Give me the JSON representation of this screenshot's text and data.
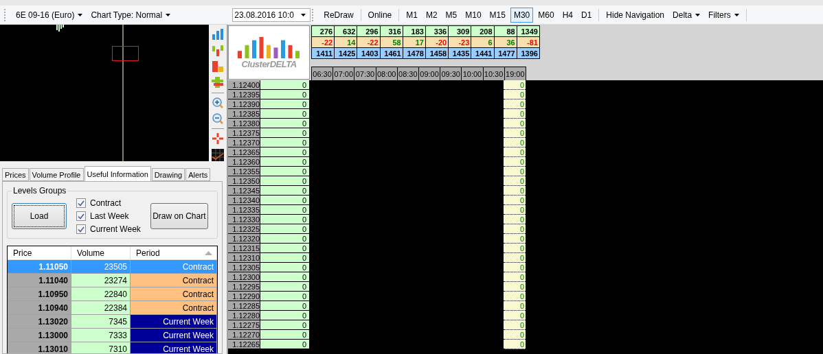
{
  "toolbar": {
    "instrument": "6E 09-16 (Euro)",
    "chart_type": "Chart Type: Normal",
    "date": "23.08.2016 10:0",
    "redraw": "ReDraw",
    "online": "Online",
    "timeframes": [
      {
        "label": "M1",
        "selected": false
      },
      {
        "label": "M2",
        "selected": false
      },
      {
        "label": "M5",
        "selected": false
      },
      {
        "label": "M10",
        "selected": false
      },
      {
        "label": "M15",
        "selected": false
      },
      {
        "label": "M30",
        "selected": true
      },
      {
        "label": "M60",
        "selected": false
      },
      {
        "label": "H4",
        "selected": false
      },
      {
        "label": "D1",
        "selected": false
      }
    ],
    "hide_navigation": "Hide Navigation",
    "delta": "Delta",
    "filters": "Filters"
  },
  "tabs": [
    {
      "label": "Prices",
      "selected": false
    },
    {
      "label": "Volume Profile",
      "selected": false
    },
    {
      "label": "Useful Information",
      "selected": true
    },
    {
      "label": "Drawing",
      "selected": false
    },
    {
      "label": "Alerts",
      "selected": false
    }
  ],
  "levels_groups": {
    "title": "Levels Groups",
    "load": "Load",
    "draw": "Draw on Chart",
    "options": [
      {
        "label": "Contract",
        "checked": true
      },
      {
        "label": "Last Week",
        "checked": true
      },
      {
        "label": "Current Week",
        "checked": true
      }
    ]
  },
  "levels_table": {
    "columns": [
      {
        "label": "Price",
        "sorted": false
      },
      {
        "label": "Volume",
        "sorted": false
      },
      {
        "label": "Period",
        "sorted": true
      }
    ],
    "rows": [
      {
        "price": "1.11050",
        "volume": "23505",
        "period": "Contract",
        "selected": true
      },
      {
        "price": "1.11040",
        "volume": "23274",
        "period": "Contract",
        "selected": false,
        "color": "#ffc080"
      },
      {
        "price": "1.10950",
        "volume": "22840",
        "period": "Contract",
        "selected": false,
        "color": "#ffc080"
      },
      {
        "price": "1.10940",
        "volume": "22384",
        "period": "Contract",
        "selected": false,
        "color": "#ffc080"
      },
      {
        "price": "1.13020",
        "volume": "7345",
        "period": "Current Week",
        "selected": false,
        "color": "#000099"
      },
      {
        "price": "1.13000",
        "volume": "7333",
        "period": "Current Week",
        "selected": false,
        "color": "#000099"
      },
      {
        "price": "1.13010",
        "volume": "7310",
        "period": "Current Week",
        "selected": false,
        "color": "#000099"
      }
    ]
  },
  "logo": {
    "text": "ClusterDELTA"
  },
  "stats_rows": [
    {
      "cells": [
        {
          "text": "276"
        },
        {
          "text": "632"
        },
        {
          "text": "296"
        },
        {
          "text": "316"
        },
        {
          "text": "183"
        },
        {
          "text": "336"
        },
        {
          "text": "309"
        },
        {
          "text": "208"
        },
        {
          "text": "88"
        },
        {
          "text": "1349"
        }
      ]
    },
    {
      "cells": [
        {
          "text": "-22",
          "color": "#ff0000"
        },
        {
          "text": "14",
          "color": "#008000"
        },
        {
          "text": "-22",
          "color": "#ff0000"
        },
        {
          "text": "58",
          "color": "#008000"
        },
        {
          "text": "17",
          "color": "#008000"
        },
        {
          "text": "-20",
          "color": "#ff0000"
        },
        {
          "text": "-23",
          "color": "#ff0000"
        },
        {
          "text": "6",
          "color": "#008000"
        },
        {
          "text": "36",
          "color": "#008000"
        },
        {
          "text": "-81",
          "color": "#ff0000"
        }
      ]
    },
    {
      "cells": [
        {
          "text": "1411"
        },
        {
          "text": "1425"
        },
        {
          "text": "1403"
        },
        {
          "text": "1461"
        },
        {
          "text": "1478"
        },
        {
          "text": "1458"
        },
        {
          "text": "1435"
        },
        {
          "text": "1441"
        },
        {
          "text": "1477"
        },
        {
          "text": "1396"
        }
      ]
    }
  ],
  "time_columns": [
    "06:30",
    "07:00",
    "07:30",
    "08:00",
    "08:30",
    "09:00",
    "09:30",
    "10:00",
    "10:30",
    "19:00"
  ],
  "ladder": [
    {
      "price": "1.12400",
      "volume": "0",
      "last": "0"
    },
    {
      "price": "1.12395",
      "volume": "0",
      "last": "0"
    },
    {
      "price": "1.12390",
      "volume": "0",
      "last": "0"
    },
    {
      "price": "1.12385",
      "volume": "0",
      "last": "0"
    },
    {
      "price": "1.12380",
      "volume": "0",
      "last": "0"
    },
    {
      "price": "1.12375",
      "volume": "0",
      "last": "0"
    },
    {
      "price": "1.12370",
      "volume": "0",
      "last": "0"
    },
    {
      "price": "1.12365",
      "volume": "0",
      "last": "0"
    },
    {
      "price": "1.12360",
      "volume": "0",
      "last": "0"
    },
    {
      "price": "1.12355",
      "volume": "0",
      "last": "0"
    },
    {
      "price": "1.12350",
      "volume": "0",
      "last": "0"
    },
    {
      "price": "1.12345",
      "volume": "0",
      "last": "0"
    },
    {
      "price": "1.12340",
      "volume": "0",
      "last": "0"
    },
    {
      "price": "1.12335",
      "volume": "0",
      "last": "0"
    },
    {
      "price": "1.12330",
      "volume": "0",
      "last": "0"
    },
    {
      "price": "1.12325",
      "volume": "0",
      "last": "0"
    },
    {
      "price": "1.12320",
      "volume": "0",
      "last": "0"
    },
    {
      "price": "1.12315",
      "volume": "0",
      "last": "0"
    },
    {
      "price": "1.12310",
      "volume": "0",
      "last": "0"
    },
    {
      "price": "1.12305",
      "volume": "0",
      "last": "0"
    },
    {
      "price": "1.12300",
      "volume": "0",
      "last": "0"
    },
    {
      "price": "1.12295",
      "volume": "0",
      "last": "0"
    },
    {
      "price": "1.12290",
      "volume": "0",
      "last": "0"
    },
    {
      "price": "1.12285",
      "volume": "0",
      "last": "0"
    },
    {
      "price": "1.12280",
      "volume": "0",
      "last": "0"
    },
    {
      "price": "1.12275",
      "volume": "0",
      "last": "0"
    },
    {
      "price": "1.12270",
      "volume": "0",
      "last": "0"
    },
    {
      "price": "1.12265",
      "volume": "0",
      "last": "0"
    }
  ]
}
